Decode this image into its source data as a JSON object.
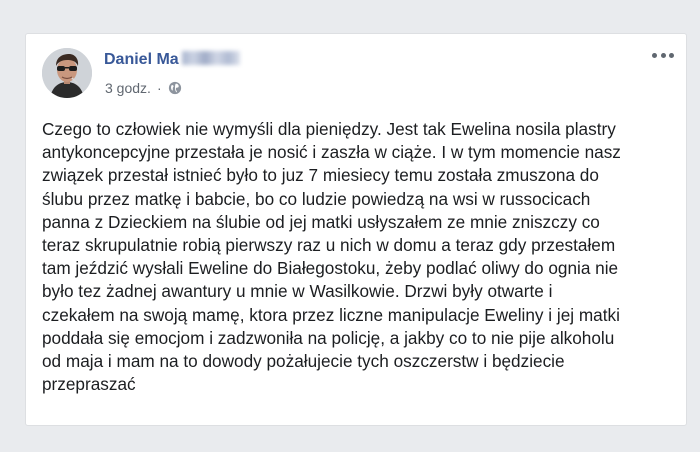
{
  "post": {
    "author_name": "Daniel Ma",
    "timestamp": "3 godz.",
    "separator": "·",
    "privacy_icon": "globe-icon",
    "more_icon": "more-options-icon",
    "lines": [
      "Czego to człowiek nie wymyśli dla pieniędzy. Jest tak Ewelina nosila plastry",
      "antykoncepcyjne przestała je nosić i zaszła w ciąże. I w tym momencie nasz",
      "związek przestał istnieć było to juz 7 miesiecy temu została zmuszona do",
      "ślubu przez matkę i babcie, bo co ludzie powiedzą na wsi w russocicach",
      "panna z Dzieckiem na ślubie od jej matki usłyszałem ze mnie zniszczy co",
      "teraz skrupulatnie robią pierwszy raz u nich w domu a teraz gdy przestałem",
      "tam jeździć wysłali Eweline do Białegostoku, żeby podlać oliwy do ognia nie",
      "było tez żadnej awantury u mnie w Wasilkowie. Drzwi były otwarte i",
      "czekałem na swoją mamę, ktora przez liczne manipulacje Eweliny i jej matki",
      "poddała się emocjom i zadzwoniła na policję, a jakby co to nie pije alkoholu",
      "od maja i mam na to dowody pożałujecie tych oszczerstw i będziecie",
      "przepraszać"
    ]
  },
  "colors": {
    "page_bg": "#e9ebee",
    "author": "#385898",
    "meta": "#606770",
    "text": "#1c1e21"
  }
}
